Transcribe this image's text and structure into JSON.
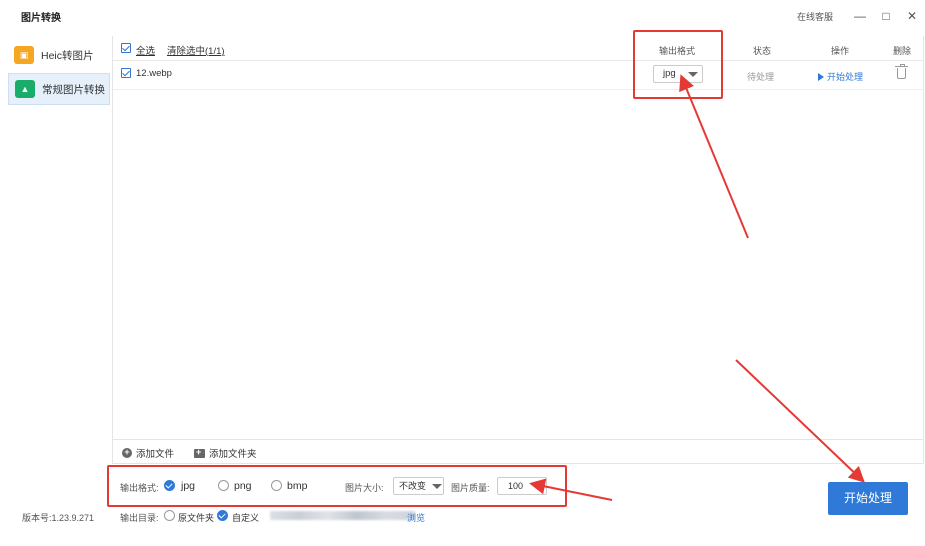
{
  "app": {
    "title": "图片转换"
  },
  "window": {
    "support": "在线客服",
    "minimize": "—",
    "maximize": "□",
    "close": "✕"
  },
  "sidebar": {
    "items": [
      {
        "label": "Heic转图片",
        "icon": "heic-image-icon",
        "icon_color": "#f5a623"
      },
      {
        "label": "常规图片转换",
        "icon": "image-convert-icon",
        "icon_color": "#1aad6a"
      }
    ],
    "version": "版本号:1.23.9.271"
  },
  "table": {
    "select_all": "全选",
    "clear_selected": "清除选中(1/1)",
    "columns": {
      "format": "输出格式",
      "status": "状态",
      "action": "操作",
      "delete": "删除"
    },
    "rows": [
      {
        "name": "12.webp",
        "format": "jpg",
        "status": "待处理",
        "action": "开始处理"
      }
    ]
  },
  "addbar": {
    "add_file": "添加文件",
    "add_folder": "添加文件夹"
  },
  "options": {
    "format_label": "输出格式:",
    "formats": [
      "jpg",
      "png",
      "bmp"
    ],
    "selected_format": "jpg",
    "size_label": "图片大小:",
    "size_value": "不改变",
    "quality_label": "图片质量:",
    "quality_value": "100",
    "dir_label": "输出目录:",
    "dir_options": [
      "原文件夹",
      "自定义"
    ],
    "selected_dir": "自定义",
    "browse": "浏览"
  },
  "start_button": "开始处理",
  "colors": {
    "accent": "#2f7ad8",
    "annotation": "#e53935",
    "active_bg": "#e6f0fb"
  }
}
